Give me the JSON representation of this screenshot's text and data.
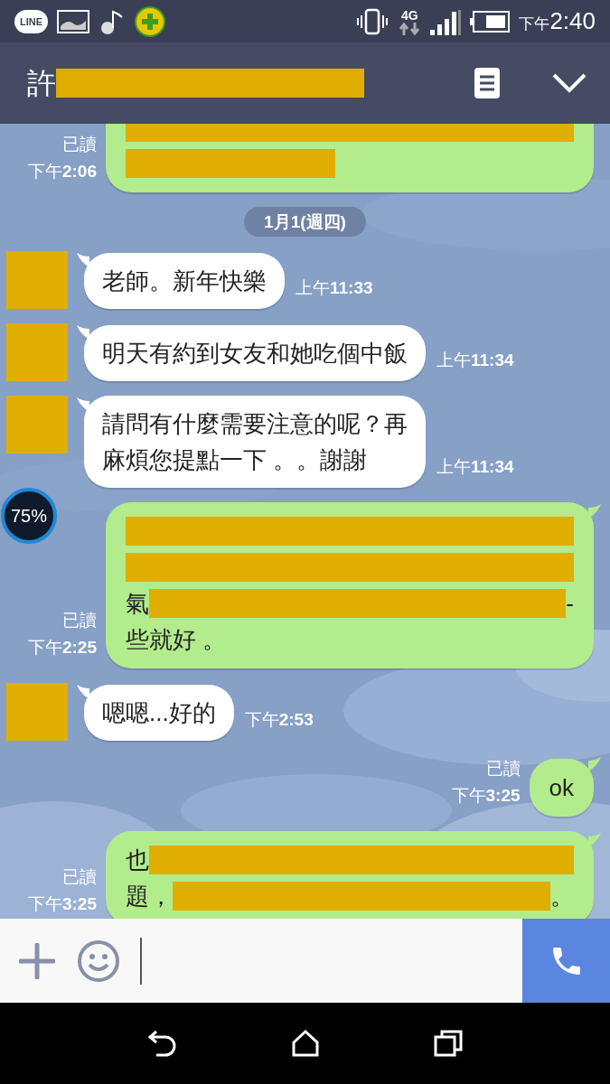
{
  "status_bar": {
    "app_badge": "LINE",
    "network": "4G",
    "time_prefix": "下午",
    "time": "2:40"
  },
  "header": {
    "title": "許"
  },
  "messages": [
    {
      "kind": "outgoing",
      "read": "已讀",
      "time": "下午**2:06**",
      "lines": [
        [
          {
            "kind": "redacted"
          }
        ],
        [
          {
            "kind": "redacted_part"
          }
        ]
      ]
    },
    {
      "kind": "date",
      "text": "1月1(週四)"
    },
    {
      "kind": "incoming",
      "time": "上午**11:33**",
      "lines": [
        [
          {
            "kind": "text",
            "text": "老師。新年快樂"
          }
        ]
      ]
    },
    {
      "kind": "incoming",
      "time": "上午**11:34**",
      "lines": [
        [
          {
            "kind": "text",
            "text": "明天有約到女友和她吃個中飯"
          }
        ]
      ]
    },
    {
      "kind": "incoming",
      "time": "上午**11:34**",
      "lines": [
        [
          {
            "kind": "text",
            "text": "請問有什麼需要注意的呢？再"
          }
        ],
        [
          {
            "kind": "text",
            "text": "麻煩您提點一下 。。謝謝"
          }
        ]
      ]
    },
    {
      "kind": "outgoing",
      "read": "已讀",
      "time": "下午**2:25**",
      "lines": [
        [
          {
            "kind": "redacted"
          }
        ],
        [
          {
            "kind": "redacted"
          }
        ],
        [
          {
            "kind": "text",
            "text": "氣"
          },
          {
            "kind": "redacted"
          },
          {
            "kind": "text",
            "text": "-"
          }
        ],
        [
          {
            "kind": "text",
            "text": "些就好 。"
          }
        ]
      ]
    },
    {
      "kind": "incoming",
      "time": "下午**2:53**",
      "lines": [
        [
          {
            "kind": "text",
            "text": "嗯嗯...好的"
          }
        ]
      ]
    },
    {
      "kind": "outgoing",
      "read": "已讀",
      "time": "下午**3:25**",
      "lines": [
        [
          {
            "kind": "text",
            "text": "ok"
          }
        ]
      ]
    },
    {
      "kind": "outgoing",
      "read": "已讀",
      "time": "下午**3:25**",
      "lines": [
        [
          {
            "kind": "text",
            "text": "也"
          },
          {
            "kind": "redacted"
          }
        ],
        [
          {
            "kind": "text",
            "text": "題，"
          },
          {
            "kind": "redacted"
          },
          {
            "kind": "text",
            "text": "。"
          }
        ]
      ]
    }
  ],
  "floating_widget": {
    "text": "75%"
  }
}
